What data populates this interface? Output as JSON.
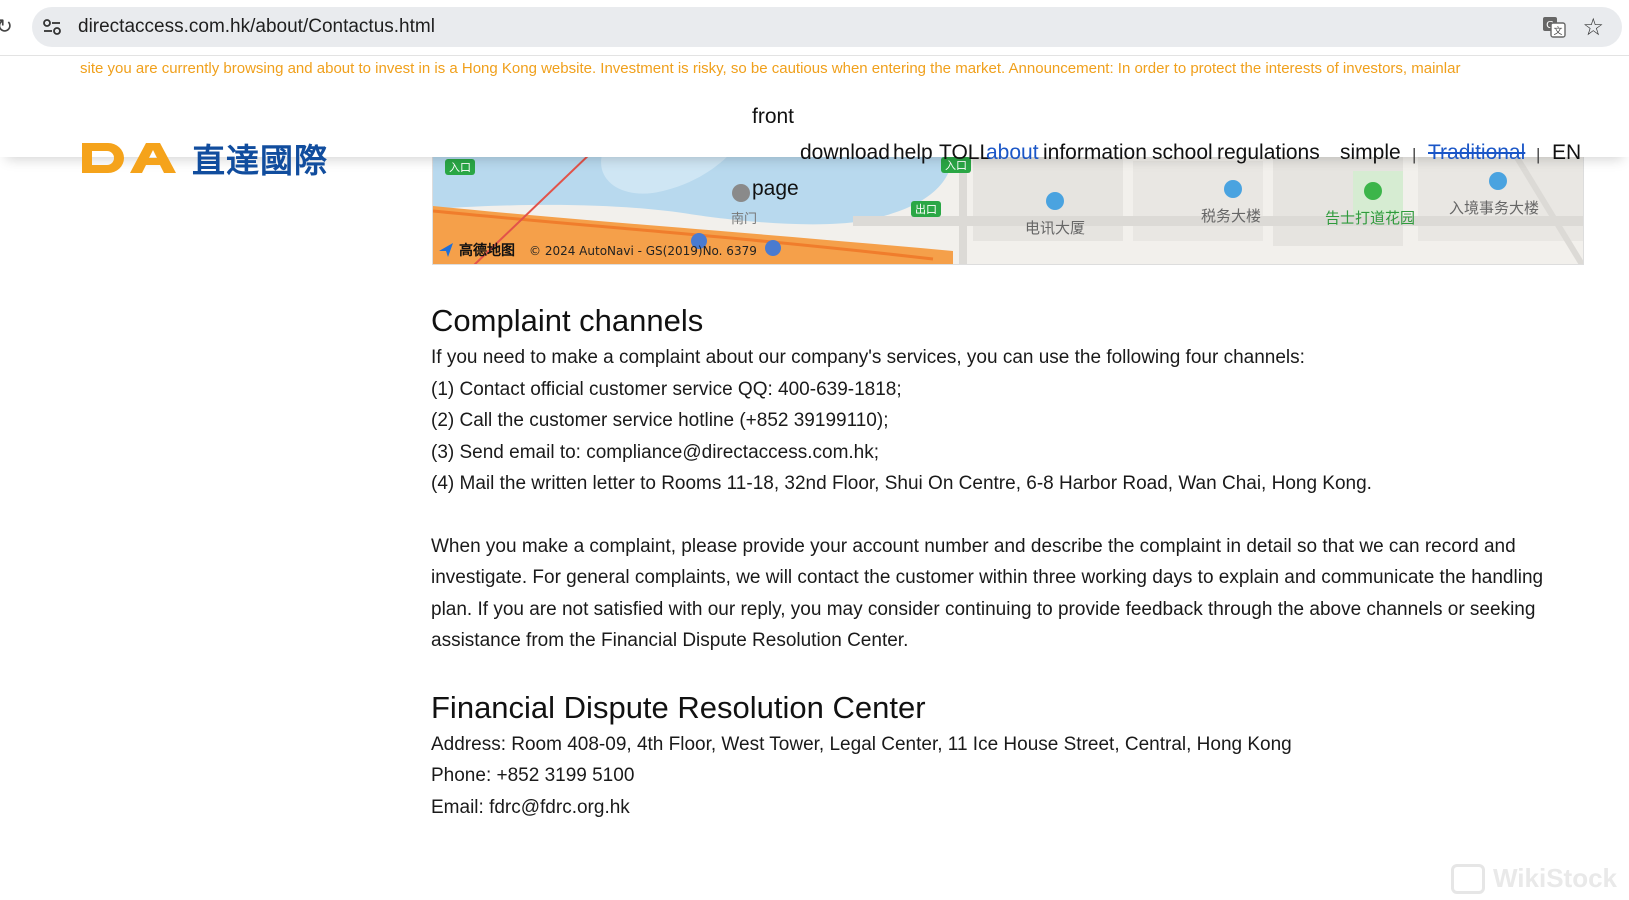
{
  "browser": {
    "url": "directaccess.com.hk/about/Contactus.html"
  },
  "ticker": {
    "text": "site you are currently browsing and about to invest in is a Hong Kong website. Investment is risky, so be cautious when entering the market. Announcement: In order to protect the interests of investors, mainlar"
  },
  "logo": {
    "mark": "DA",
    "name": "直達國際"
  },
  "nav": {
    "front": "front",
    "page": "page",
    "download": "download",
    "help": "help",
    "toll": "TOLL",
    "about": "about",
    "information": "information",
    "school": "school",
    "regulations": "regulations",
    "simple": "simple",
    "sep": "|",
    "traditional": "Traditional",
    "en": "EN"
  },
  "map": {
    "labels": {
      "entrance1": "入口",
      "entrance2": "入口",
      "exit": "出口",
      "south_gate": "南门",
      "telecom": "电讯大厦",
      "tax": "税务大楼",
      "garden": "告士打道花园",
      "immigration": "入境事务大楼"
    },
    "brand": "高德地图",
    "copyright": "© 2024 AutoNavi - GS(2019)No. 6379"
  },
  "complaints": {
    "title": "Complaint channels",
    "intro": "If you need to make a complaint about our company's services, you can use the following four channels:",
    "items": [
      "(1) Contact official customer service QQ: 400-639-1818;",
      "(2) Call the customer service hotline (+852 39199110);",
      "(3) Send email to: compliance@directaccess.com.hk;",
      "(4) Mail the written letter to Rooms 11-18, 32nd Floor, Shui On Centre, 6-8 Harbor Road, Wan Chai, Hong Kong."
    ],
    "detail": "When you make a complaint, please provide your account number and describe the complaint in detail so that we can record and investigate. For general complaints, we will contact the customer within three working days to explain and communicate the handling plan. If you are not satisfied with our reply, you may consider continuing to provide feedback through the above channels or seeking assistance from the Financial Dispute Resolution Center."
  },
  "fdrc": {
    "title": "Financial Dispute Resolution Center",
    "address": "Address: Room 408-09, 4th Floor, West Tower, Legal Center, 11 Ice House Street, Central, Hong Kong",
    "phone": "Phone: +852 3199 5100",
    "email": "Email: fdrc@fdrc.org.hk"
  },
  "watermark": "WikiStock",
  "colors": {
    "ticker": "#f0a01c",
    "logo_orange": "#f5a31b",
    "logo_blue": "#114d9e",
    "nav_active": "#1a56c7"
  }
}
